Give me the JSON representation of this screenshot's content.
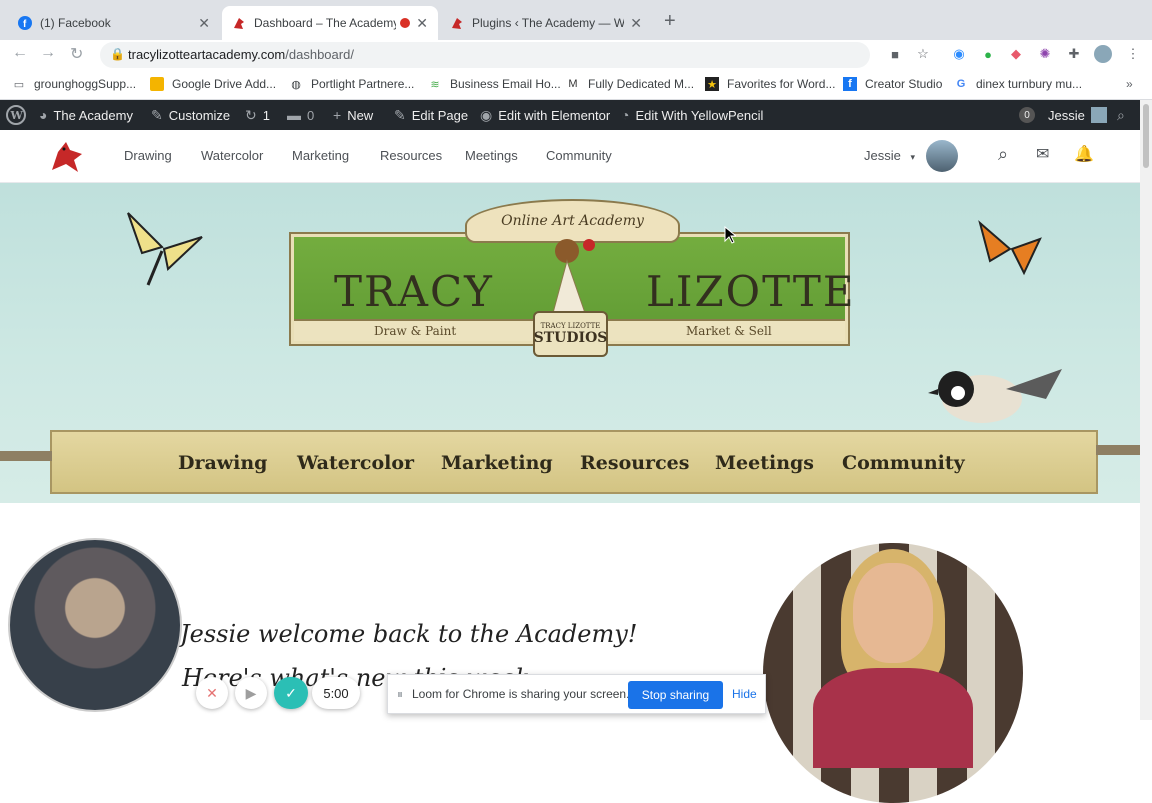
{
  "browser": {
    "tabs": [
      {
        "title": "(1) Facebook",
        "icon": "facebook-icon",
        "color": "#1877f2"
      },
      {
        "title": "Dashboard – The Academy",
        "icon": "cardinal-icon",
        "color": "#c62828",
        "active": true
      },
      {
        "title": "Plugins ‹ The Academy — Wor",
        "icon": "cardinal-icon",
        "color": "#c62828"
      }
    ],
    "url_host": "tracylizotteartacademy.com",
    "url_path": "/dashboard/",
    "bookmarks": [
      "grounghoggSupp...",
      "Google Drive Add...",
      "Portlight Partnere...",
      "Business Email Ho...",
      "Fully Dedicated M...",
      "Favorites for Word...",
      "Creator Studio",
      "dinex turnbury mu..."
    ],
    "more_bookmarks": "»"
  },
  "wpbar": {
    "site": "The Academy",
    "customize": "Customize",
    "updates": "1",
    "comments": "0",
    "new": "New",
    "edit_page": "Edit Page",
    "elementor": "Edit with Elementor",
    "yellowpencil": "Edit With YellowPencil",
    "notif_count": "0",
    "user": "Jessie"
  },
  "site_nav": [
    "Drawing",
    "Watercolor",
    "Marketing",
    "Resources",
    "Meetings",
    "Community"
  ],
  "user_menu": "Jessie",
  "hero": {
    "ribbon": "Online Art Academy",
    "name_left": "TRACY",
    "name_right": "LIZOTTE",
    "tag_left": "Draw & Paint",
    "tag_right": "Market & Sell",
    "stamp_top": "TRACY LIZOTTE",
    "stamp_bottom": "STUDIOS"
  },
  "banner_nav": [
    "Drawing",
    "Watercolor",
    "Marketing",
    "Resources",
    "Meetings",
    "Community"
  ],
  "welcome": "Jessie welcome back to the Academy!",
  "welcome2": "Here's what's new this week...",
  "loom": {
    "timer": "5:00",
    "message": "Loom for Chrome is sharing your screen.",
    "stop": "Stop sharing",
    "hide": "Hide"
  }
}
